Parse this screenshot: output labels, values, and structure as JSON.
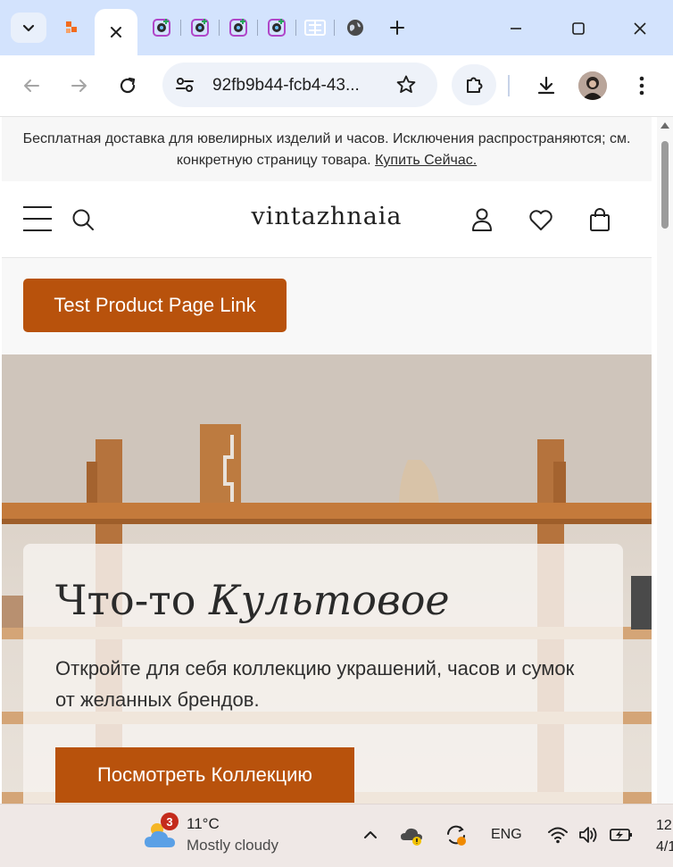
{
  "browser": {
    "tabs": [
      {
        "icon": "relay-favicon-icon",
        "active": false
      },
      {
        "icon": "close-icon",
        "active": true
      },
      {
        "icon": "camera-plus-favicon-icon",
        "active": false
      },
      {
        "icon": "camera-plus-favicon-icon",
        "active": false
      },
      {
        "icon": "camera-plus-favicon-icon",
        "active": false
      },
      {
        "icon": "camera-plus-favicon-icon",
        "active": false
      },
      {
        "icon": "grid-favicon-icon",
        "active": false
      },
      {
        "icon": "globe-favicon-icon",
        "active": false
      }
    ],
    "new_tab_symbol": "+",
    "url": "92fb9b44-fcb4-43...",
    "accent_color": "#d3e3fd"
  },
  "page": {
    "announcement": {
      "text": "Бесплатная доставка для ювелирных изделий и часов. Исключения распространяются; см. конкретную страницу товара.",
      "link": "Купить Сейчас."
    },
    "header": {
      "brand": "vintazhnaia"
    },
    "test_button": "Test Product Page Link",
    "hero": {
      "title_plain": "Что-то ",
      "title_italic": "Культовое",
      "subtitle": "Откройте для себя коллекцию украшений, часов и сумок от желанных брендов.",
      "button": "Посмотреть Коллекцию"
    },
    "brand_color": "#b8520c"
  },
  "taskbar": {
    "weather": {
      "badge": "3",
      "temp": "11°C",
      "desc": "Mostly cloudy"
    },
    "language": "ENG",
    "clock_line1": "12",
    "clock_line2": "4/1"
  }
}
